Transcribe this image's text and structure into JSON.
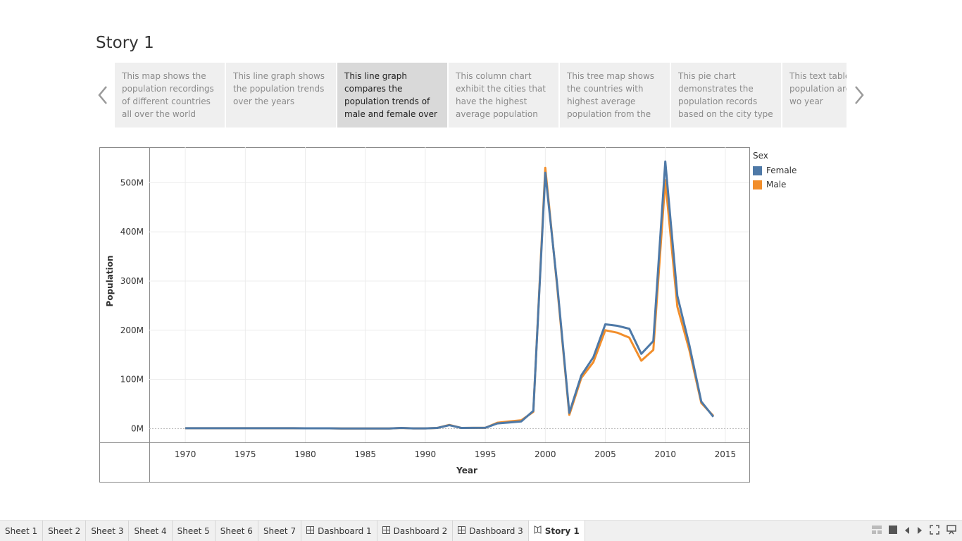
{
  "story": {
    "title": "Story 1",
    "captions": [
      {
        "text": "This map shows the population recordings of different countries all over the world",
        "active": false
      },
      {
        "text": "This line graph shows the population trends over the years",
        "active": false
      },
      {
        "text": "This line graph compares the population trends of male and female over",
        "active": true
      },
      {
        "text": "This column chart exhibit the cities that have the highest average population",
        "active": false
      },
      {
        "text": "This tree map shows the countries with highest average population from the",
        "active": false
      },
      {
        "text": "This pie chart demonstrates the population records based on the city type",
        "active": false
      },
      {
        "text": "This text table the population around the wo year",
        "active": false
      }
    ]
  },
  "legend": {
    "title": "Sex",
    "items": [
      {
        "label": "Female",
        "color": "#4e79a7"
      },
      {
        "label": "Male",
        "color": "#f28e2b"
      }
    ]
  },
  "chart_data": {
    "type": "line",
    "xlabel": "Year",
    "ylabel": "Population",
    "x_ticks": [
      "1970",
      "1975",
      "1980",
      "1985",
      "1990",
      "1995",
      "2000",
      "2005",
      "2010",
      "2015"
    ],
    "y_ticks": [
      "0M",
      "100M",
      "200M",
      "300M",
      "400M",
      "500M"
    ],
    "xlim": [
      1967,
      2017
    ],
    "ylim": [
      -28,
      572
    ],
    "grid": true,
    "x": [
      1970,
      1971,
      1972,
      1973,
      1974,
      1975,
      1976,
      1977,
      1978,
      1979,
      1980,
      1981,
      1982,
      1983,
      1984,
      1985,
      1986,
      1987,
      1988,
      1989,
      1990,
      1991,
      1992,
      1993,
      1994,
      1995,
      1996,
      1997,
      1998,
      1999,
      2000,
      2001,
      2002,
      2003,
      2004,
      2005,
      2006,
      2007,
      2008,
      2009,
      2010,
      2011,
      2012,
      2013,
      2014
    ],
    "series": [
      {
        "name": "Male",
        "color": "#f28e2b",
        "values": [
          0.8,
          0.8,
          0.8,
          0.8,
          0.8,
          0.8,
          0.8,
          0.8,
          0.8,
          0.8,
          0.6,
          0.6,
          0.6,
          0.4,
          0.4,
          0.4,
          0.4,
          0.4,
          1.3,
          0.5,
          0.5,
          1.3,
          7.5,
          1.3,
          1.5,
          1.5,
          12,
          14.5,
          17,
          34,
          530,
          285,
          28,
          103,
          135,
          200,
          195,
          185,
          138,
          160,
          505,
          248,
          160,
          52,
          26
        ]
      },
      {
        "name": "Female",
        "color": "#4e79a7",
        "values": [
          0.8,
          0.8,
          0.8,
          0.8,
          0.8,
          0.8,
          0.8,
          0.8,
          0.8,
          0.8,
          0.6,
          0.6,
          0.6,
          0.4,
          0.4,
          0.4,
          0.4,
          0.4,
          1.4,
          0.5,
          0.5,
          1.3,
          7.0,
          1.3,
          1.5,
          1.6,
          10.5,
          12.5,
          14.5,
          36,
          520,
          290,
          32,
          108,
          145,
          212,
          209,
          203,
          152,
          178,
          543,
          270,
          170,
          55,
          24
        ]
      }
    ]
  },
  "tabs": [
    {
      "label": "Sheet 1",
      "icon": "",
      "active": false
    },
    {
      "label": "Sheet 2",
      "icon": "",
      "active": false
    },
    {
      "label": "Sheet 3",
      "icon": "",
      "active": false
    },
    {
      "label": "Sheet 4",
      "icon": "",
      "active": false
    },
    {
      "label": "Sheet 5",
      "icon": "",
      "active": false
    },
    {
      "label": "Sheet 6",
      "icon": "",
      "active": false
    },
    {
      "label": "Sheet 7",
      "icon": "",
      "active": false
    },
    {
      "label": "Dashboard 1",
      "icon": "dashboard-icon",
      "active": false
    },
    {
      "label": "Dashboard 2",
      "icon": "dashboard-icon",
      "active": false
    },
    {
      "label": "Dashboard 3",
      "icon": "dashboard-icon",
      "active": false
    },
    {
      "label": "Story 1",
      "icon": "story-icon",
      "active": true
    }
  ]
}
